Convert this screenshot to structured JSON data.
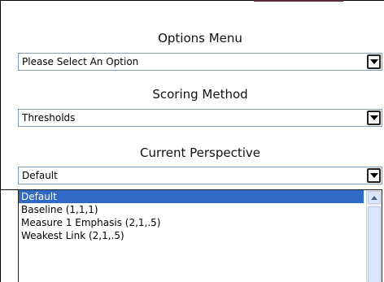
{
  "options": {
    "label": "Options Menu",
    "selected": "Please Select An Option"
  },
  "scoring": {
    "label": "Scoring Method",
    "selected": "Thresholds"
  },
  "perspective": {
    "label": "Current Perspective",
    "selected": "Default",
    "items": [
      {
        "label": "Default",
        "selected": true
      },
      {
        "label": "Baseline (1,1,1)",
        "selected": false
      },
      {
        "label": "Measure 1 Emphasis (2,1,.5)",
        "selected": false
      },
      {
        "label": "Weakest Link (2,1,.5)",
        "selected": false
      }
    ]
  },
  "icons": {
    "dropdown": "chevron-down-icon",
    "scroll_up": "scroll-up-arrow-icon"
  },
  "colors": {
    "selection": "#3169c6",
    "select_border": "#7f9db9",
    "scrollbar": "#dbe6fb"
  }
}
